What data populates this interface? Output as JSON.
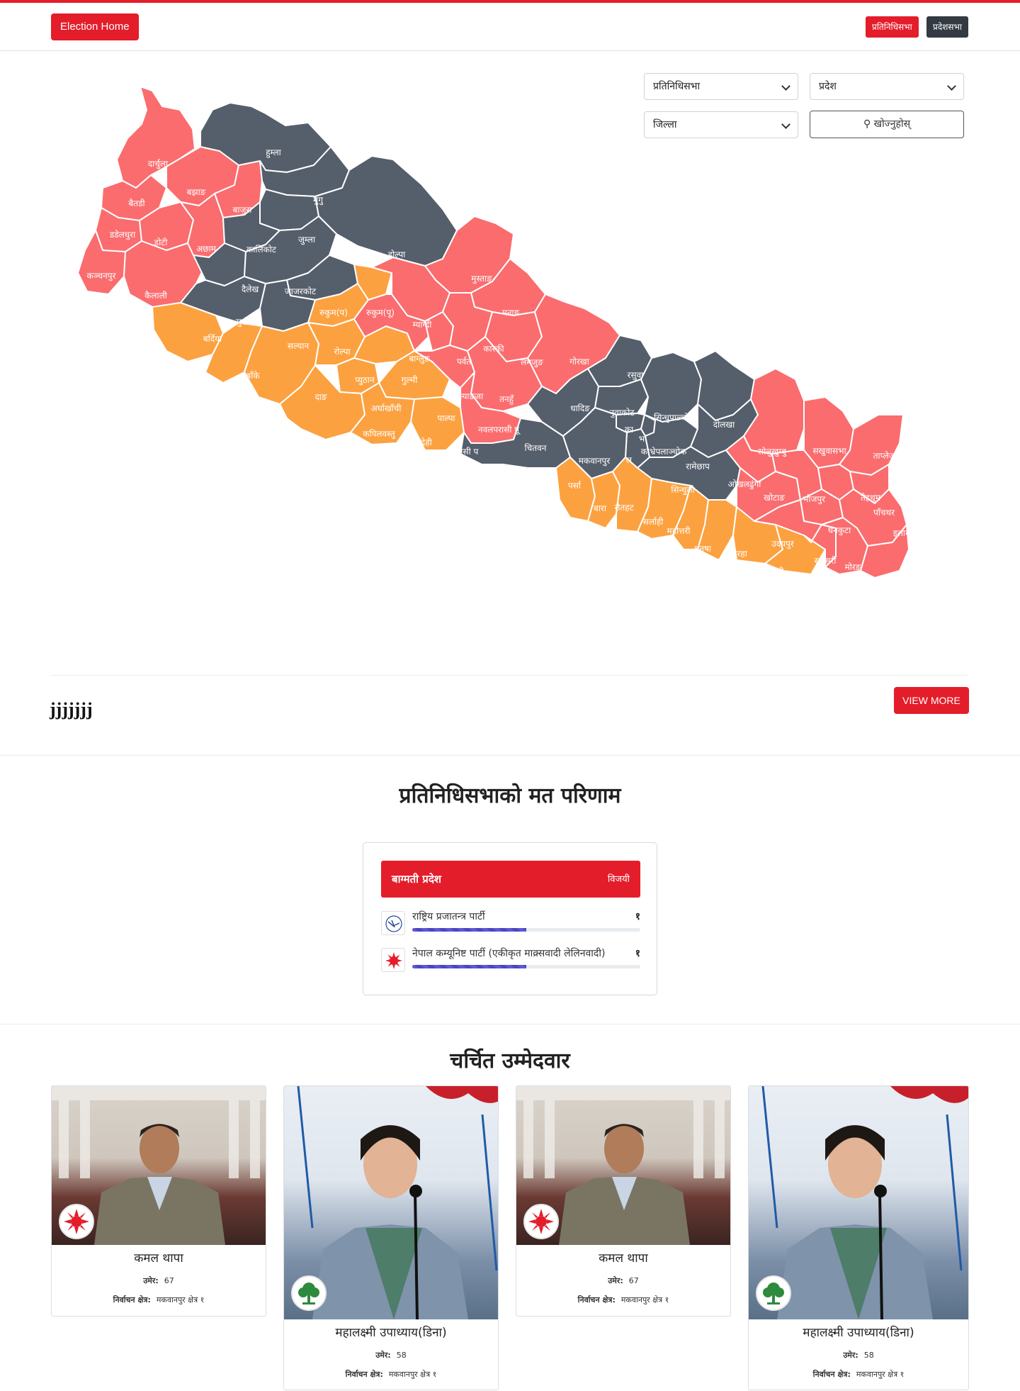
{
  "header": {
    "home_label": "Election Home",
    "btn_pratinidhi": "प्रतिनिधिसभा",
    "btn_pradesh": "प्रदेशसभा"
  },
  "filters": {
    "house": "प्रतिनिधिसभा",
    "province": "प्रदेश",
    "district": "जिल्ला",
    "search_label": "⚲ खोज्नुहोस्"
  },
  "map": {
    "colors": {
      "red": "#fa6c6e",
      "dark": "#555e6b",
      "orange": "#fca140"
    },
    "districts": {
      "darchula": "दार्चुला",
      "bajhang": "बझाङ",
      "baitadi": "बैतडी",
      "bajura": "बाजुरा",
      "dadeldhura": "डडेलधुरा",
      "doti": "डोटी",
      "achham": "अछाम",
      "kanchanpur": "कञ्चनपुर",
      "kailali": "कैलाली",
      "humla": "हुम्ला",
      "mugu": "मुगु",
      "jumla": "जुम्ला",
      "kalikot": "कालिकोट",
      "dolpa": "डोल्पा",
      "dailekh": "दैलेख",
      "jajarkot": "जाजरकोट",
      "surkhet": "सुर्खेत",
      "rukum_e": "रुकुम(पू)",
      "rukum_w": "रुकुम(प)",
      "salyan": "सल्यान",
      "bardiya": "बर्दिया",
      "banke": "बाँके",
      "dang": "दाङ",
      "rolpa": "रोल्पा",
      "pyuthan": "प्युठान",
      "gulmi": "गुल्मी",
      "arghakhanchi": "अर्घाखाँची",
      "palpa": "पाल्पा",
      "kapilvastu": "कपिलवस्तु",
      "rupandehi": "रुपन्देही",
      "parasi": "परासी प",
      "nawalparasi": "नवलपरासी पू",
      "mustang": "मुस्ताङ",
      "myagdi": "म्याग्दी",
      "baglung": "बाग्लुङ",
      "parbat": "पर्वत",
      "manang": "मनाङ",
      "kaski": "कास्की",
      "lamjung": "लमजुङ",
      "gorkha": "गोरखा",
      "syangja": "स्याङजा",
      "tanahun": "तनहुँ",
      "chitwan": "चितवन",
      "rasuwa": "रसुवा",
      "nuwakot": "नुवाकोट",
      "dhading": "धादिङ",
      "sindhupalchok": "सिन्धुपाल्चोक",
      "dolakha": "दोलखा",
      "kathmandu": "का",
      "bhaktapur": "भ",
      "lalitpur": "ल",
      "kavre": "काभ्रेपलाञ्चोक",
      "ramechhap": "रामेछाप",
      "makwanpur": "मकवानपुर",
      "sindhuli": "सिन्धुली",
      "parsa": "पर्सा",
      "bara": "बारा",
      "rautahat": "रौतहट",
      "sarlahi": "सर्लाही",
      "mahottari": "महोत्तरी",
      "dhanusha": "धनुषा",
      "siraha": "सिरहा",
      "saptari": "सप्तरी",
      "solukhumbu": "सोलुखुम्बु",
      "sankhuwasabha": "सखुवासभा",
      "taplejung": "ताप्लेजुङ",
      "okhaldhunga": "ओखलढुंगा",
      "khotang": "खोटाङ",
      "bhojpur": "भोजपुर",
      "terhathum": "तेह्रथुम",
      "panchthar": "पाँचथर",
      "dhankuta": "धनकुटा",
      "udayapur": "उदयपुर",
      "ilam": "इलाम",
      "sunsari": "सुनसरी",
      "morang": "मोरङ",
      "jhapa": "झापा"
    }
  },
  "news": {
    "title": "jjjjjjj",
    "view_more": "VIEW MORE"
  },
  "results": {
    "section_title": "प्रतिनिधिसभाको मत परिणाम",
    "province": "बाग्मती प्रदेश",
    "winner_label": "विजयी",
    "parties": [
      {
        "name": "राष्ट्रिय प्रजातन्त्र पार्टी",
        "seats": "१",
        "share": 0.5,
        "logo": "plough-icon"
      },
      {
        "name": "नेपाल कम्यूनिष्ट पार्टी (एकीकृत माक्र्सवादी लेलिनवादी)",
        "seats": "१",
        "share": 0.5,
        "logo": "sun-icon"
      }
    ]
  },
  "candidates": {
    "section_title": "चर्चित उम्मेदवार",
    "age_label": "उमेर:",
    "constituency_label": "निर्वाचन क्षेत्र:",
    "items": [
      {
        "name": "कमल थापा",
        "age": "67",
        "constituency": "मकवानपुर क्षेत्र १",
        "party_icon": "sun-icon"
      },
      {
        "name": "महालक्ष्मी उपाध्याय(डिना)",
        "age": "58",
        "constituency": "मकवानपुर क्षेत्र १",
        "party_icon": "tree-icon"
      },
      {
        "name": "कमल थापा",
        "age": "67",
        "constituency": "मकवानपुर क्षेत्र १",
        "party_icon": "sun-icon"
      },
      {
        "name": "महालक्ष्मी उपाध्याय(डिना)",
        "age": "58",
        "constituency": "मकवानपुर क्षेत्र १",
        "party_icon": "tree-icon"
      }
    ]
  }
}
